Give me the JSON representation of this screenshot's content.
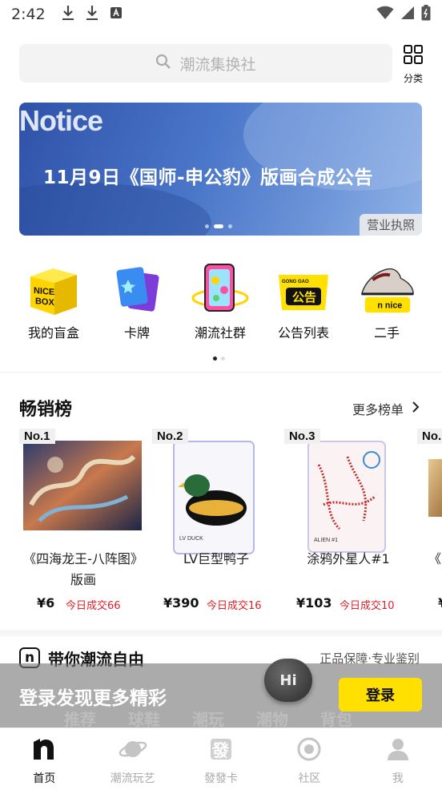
{
  "status": {
    "time": "2:42"
  },
  "search": {
    "placeholder": "潮流集换社"
  },
  "category": {
    "label": "分类"
  },
  "banner": {
    "notice": "Notice",
    "title": "11月9日《国师-申公豹》版画合成公告",
    "license": "营业执照",
    "page_count": 3,
    "active_page": 2
  },
  "quick": {
    "items": [
      {
        "label": "我的盲盒",
        "icon": "nice-box-icon",
        "art": "NICE\nBOX"
      },
      {
        "label": "卡牌",
        "icon": "cards-icon"
      },
      {
        "label": "潮流社群",
        "icon": "community-phone-icon"
      },
      {
        "label": "公告列表",
        "icon": "announcement-icon",
        "art": "公告",
        "art_small": "GONG GAO"
      },
      {
        "label": "二手",
        "icon": "second-hand-sneaker-icon",
        "art": "nice"
      }
    ]
  },
  "ranking": {
    "title": "畅销榜",
    "more": "更多榜单",
    "items": [
      {
        "no": "No.1",
        "name": "《四海龙王-八阵图》版画",
        "price": "¥6",
        "deal": "今日成交66"
      },
      {
        "no": "No.2",
        "name": "LV巨型鸭子",
        "price": "¥390",
        "deal": "今日成交16"
      },
      {
        "no": "No.3",
        "name": "涂鸦外星人#1",
        "price": "¥103",
        "deal": "今日成交10"
      },
      {
        "no": "No.",
        "name": "《",
        "price": "¥",
        "deal": ""
      }
    ]
  },
  "slogan": {
    "logo": "n",
    "text": "带你潮流自由",
    "right": "正品保障·专业鉴别"
  },
  "login": {
    "text": "登录发现更多精彩",
    "button": "登录",
    "hi": "Hi"
  },
  "ghost_tabs": [
    "推荐",
    "球鞋",
    "潮玩",
    "潮物",
    "背包"
  ],
  "tabbar": {
    "items": [
      {
        "label": "首页",
        "active": true
      },
      {
        "label": "潮流玩艺",
        "active": false
      },
      {
        "label": "發發卡",
        "active": false
      },
      {
        "label": "社区",
        "active": false
      },
      {
        "label": "我",
        "active": false
      }
    ]
  },
  "colors": {
    "accent": "#ffe000",
    "deal_red": "#e0202a",
    "banner_blue": "#4a76c9"
  }
}
